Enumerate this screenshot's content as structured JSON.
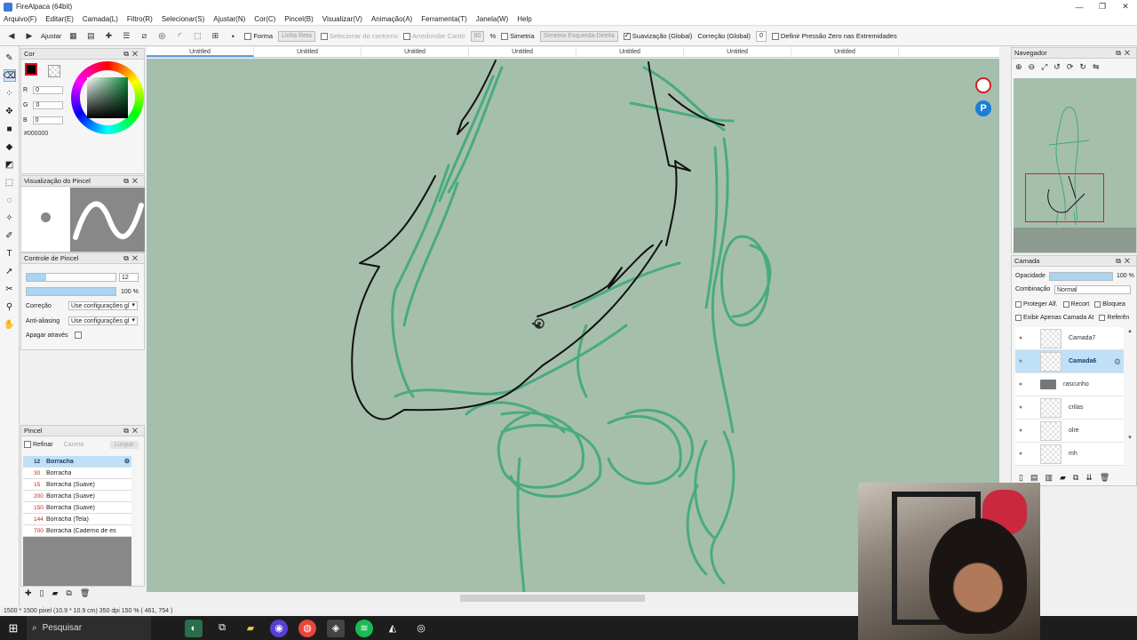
{
  "window": {
    "title": "FireAlpaca (64bit)",
    "controls": [
      "—",
      "❐",
      "✕"
    ]
  },
  "menu": [
    "Arquivo(F)",
    "Editar(E)",
    "Camada(L)",
    "Filtro(R)",
    "Selecionar(S)",
    "Ajustar(N)",
    "Cor(C)",
    "Pincel(B)",
    "Visualizar(V)",
    "Animação(A)",
    "Ferramenta(T)",
    "Janela(W)",
    "Help"
  ],
  "toolbar": {
    "ajustar": "Ajustar",
    "forma": "Forma",
    "forma_value": "Linha Reta",
    "selecionar_contorno": "Selecionar do contorno",
    "arredondar_canto": "Arredondar Canto",
    "arredondar_value": "80",
    "percent": "%",
    "simetria": "Simetria",
    "simetria_value": "Simetria Esquerda-Direita",
    "suavizacao": "Suavização (Global)",
    "correcao": "Correção (Global)",
    "correcao_value": "0",
    "pressao": "Definir Pressão Zero nas Extremidades"
  },
  "color_panel": {
    "title": "Cor",
    "r_label": "R",
    "r_value": "0",
    "g_label": "G",
    "g_value": "0",
    "b_label": "B",
    "b_value": "0",
    "hex": "#000000",
    "foreground": "#000000"
  },
  "brush_preview": {
    "title": "Visualização do Pincel"
  },
  "brush_control": {
    "title": "Controle de Pincel",
    "size": "12",
    "opacity": "100 %",
    "correcao_label": "Correção",
    "correcao_value": "Use configurações gl",
    "antialias_label": "Anti-aliasing",
    "antialias_value": "Use configurações gl",
    "apagar_label": "Apagar através"
  },
  "pincel_panel": {
    "title": "Pincel",
    "refinar": "Refinar",
    "caneta": "Caneta",
    "limpar": "Limpar",
    "brushes": [
      {
        "size": "12",
        "name": "Borracha",
        "selected": true
      },
      {
        "size": "30",
        "name": "Borracha",
        "selected": false
      },
      {
        "size": "15",
        "name": "Borracha (Suave)",
        "selected": false
      },
      {
        "size": "200",
        "name": "Borracha (Suave)",
        "selected": false
      },
      {
        "size": "150",
        "name": "Borracha (Suave)",
        "selected": false
      },
      {
        "size": "144",
        "name": "Borracha (Tela)",
        "selected": false
      },
      {
        "size": "700",
        "name": "Borracha (Caderno de es",
        "selected": false
      }
    ]
  },
  "tabs": [
    "Untitled",
    "Untitled",
    "Untitled",
    "Untitled",
    "Untitled",
    "Untitled",
    "Untitled"
  ],
  "navigator": {
    "title": "Navegador"
  },
  "layer_panel": {
    "title": "Camada",
    "opacity_label": "Opacidade",
    "opacity_value": "100 %",
    "blend_label": "Combinação",
    "blend_value": "Normal",
    "protect_alpha": "Proteger Alf.",
    "clip": "Recort",
    "lock": "Bloquea",
    "show_only": "Exibir Apenas Camada At",
    "reference": "Referên",
    "layers": [
      {
        "name": "Camada7",
        "type": "layer",
        "selected": false
      },
      {
        "name": "Camada6",
        "type": "layer",
        "selected": true
      },
      {
        "name": "rascunho",
        "type": "folder",
        "selected": false
      },
      {
        "name": "crilas",
        "type": "layer",
        "selected": false
      },
      {
        "name": "olre",
        "type": "layer",
        "selected": false
      },
      {
        "name": "mh",
        "type": "layer",
        "selected": false
      }
    ]
  },
  "status": "1500 * 1500 pixel  (10.9 * 10.9 cm)  350 dpi  150 %  ( 461, 754 )",
  "taskbar": {
    "search": "Pesquisar"
  },
  "colors": {
    "canvas": "#a6bfad",
    "sketch": "#3fa97a",
    "accent": "#5aa0e0",
    "selection": "#bfe0f7"
  }
}
